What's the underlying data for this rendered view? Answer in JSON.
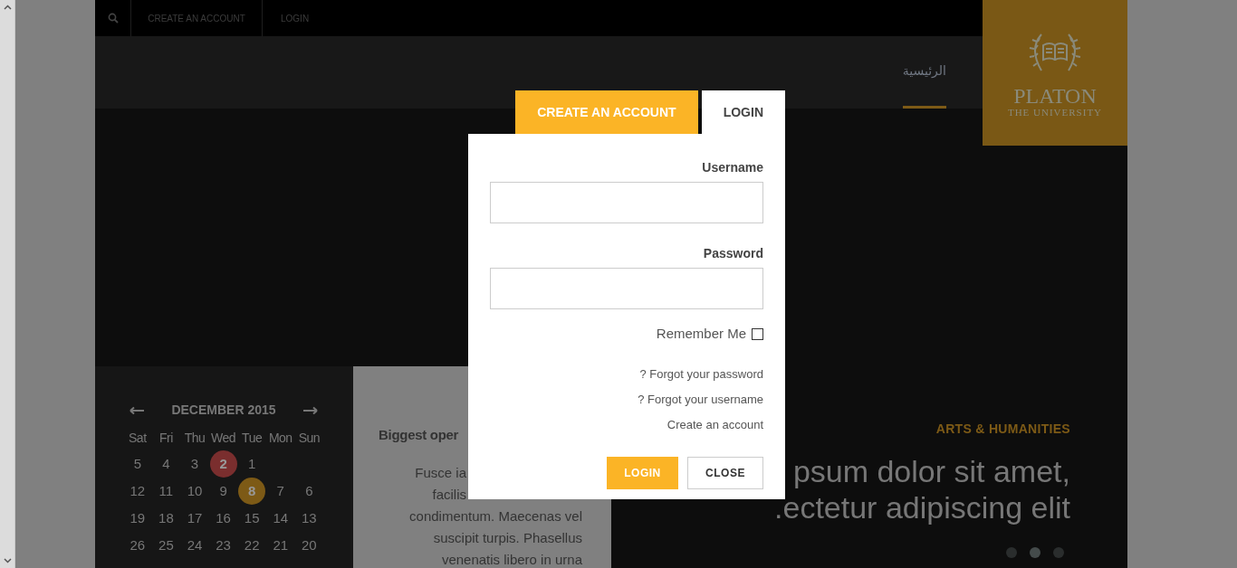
{
  "topbar": {
    "links": [
      {
        "label": "CREATE AN ACCOUNT"
      },
      {
        "label": "LOGIN"
      }
    ]
  },
  "nav": {
    "items": [
      {
        "label": "الرئيسية",
        "selected": true
      }
    ]
  },
  "logo": {
    "title": "PLATON",
    "subtitle": "THE UNIVERSITY"
  },
  "calendar": {
    "month": "DECEMBER 2015",
    "weekdays": [
      "Sat",
      "Fri",
      "Thu",
      "Wed",
      "Tue",
      "Mon",
      "Sun"
    ],
    "weeks": [
      [
        {
          "day": "5"
        },
        {
          "day": "4"
        },
        {
          "day": "3"
        },
        {
          "day": "2",
          "color": "#7a2e2e"
        },
        {
          "day": "1"
        }
      ],
      [
        {
          "day": "12"
        },
        {
          "day": "11"
        },
        {
          "day": "10"
        },
        {
          "day": "9"
        },
        {
          "day": "8",
          "color": "#7d5a16"
        },
        {
          "day": "7"
        },
        {
          "day": "6"
        }
      ],
      [
        {
          "day": "19"
        },
        {
          "day": "18"
        },
        {
          "day": "17"
        },
        {
          "day": "16"
        },
        {
          "day": "15"
        },
        {
          "day": "14"
        },
        {
          "day": "13"
        }
      ],
      [
        {
          "day": "26"
        },
        {
          "day": "25"
        },
        {
          "day": "24"
        },
        {
          "day": "23"
        },
        {
          "day": "22"
        },
        {
          "day": "21"
        },
        {
          "day": "20"
        }
      ]
    ]
  },
  "article": {
    "title": "Biggest oper",
    "lines": [
      {
        "text": "Fusce ia",
        "kind": "clipped"
      },
      {
        "text": "facilis",
        "kind": "clipped"
      },
      {
        "text": "condimentum. Maecenas vel",
        "kind": "full"
      },
      {
        "text": "suscipit turpis. Phasellus",
        "kind": "full"
      },
      {
        "text": "venenatis libero in urna",
        "kind": "full"
      }
    ]
  },
  "slide": {
    "category": "ARTS & HUMANITIES",
    "lines": [
      "psum dolor sit amet,",
      ".ectetur adipiscing elit"
    ],
    "dots": [
      {
        "selected": false
      },
      {
        "selected": true
      },
      {
        "selected": false
      }
    ]
  },
  "modal": {
    "tabs": [
      {
        "label": "CREATE AN ACCOUNT",
        "selected": false
      },
      {
        "label": "LOGIN",
        "selected": true
      }
    ],
    "fields": [
      {
        "label": "Username"
      },
      {
        "label": "Password"
      }
    ],
    "remember": {
      "label": "Remember Me",
      "checked": false
    },
    "links": [
      "? Forgot your password",
      "? Forgot your username",
      "Create an account"
    ],
    "buttons": [
      {
        "label": "LOGIN",
        "kind": "primary"
      },
      {
        "label": "CLOSE",
        "kind": "secondary"
      }
    ]
  }
}
